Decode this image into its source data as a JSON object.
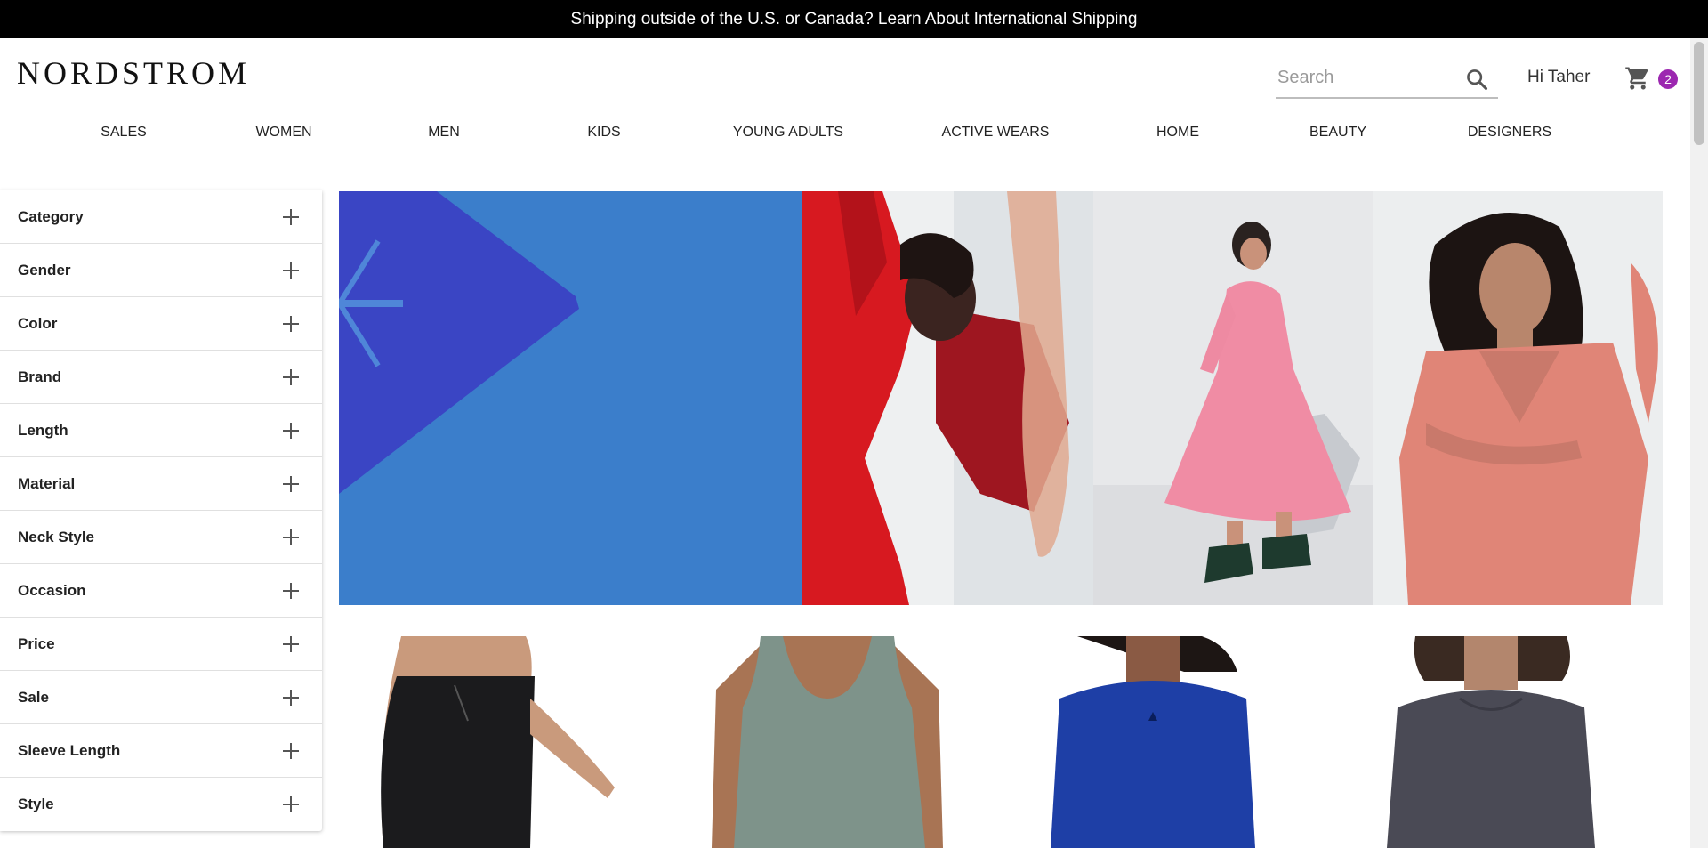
{
  "announcement": "Shipping outside of the U.S. or Canada? Learn About International Shipping",
  "header": {
    "logo": "NORDSTROM",
    "search_placeholder": "Search",
    "greeting": "Hi Taher",
    "cart_count": "2"
  },
  "nav": [
    "SALES",
    "WOMEN",
    "MEN",
    "KIDS",
    "YOUNG ADULTS",
    "ACTIVE WEARS",
    "HOME",
    "BEAUTY",
    "DESIGNERS"
  ],
  "filters": [
    "Category",
    "Gender",
    "Color",
    "Brand",
    "Length",
    "Material",
    "Neck Style",
    "Occasion",
    "Price",
    "Sale",
    "Sleeve Length",
    "Style"
  ],
  "colors": {
    "accent": "#9c27b0",
    "hero_blue": "#3b7ecb",
    "hero_dark_blue": "#3a45c4",
    "announcement_bg": "#000000"
  },
  "icons": [
    "search-icon",
    "cart-icon",
    "plus-icon"
  ]
}
